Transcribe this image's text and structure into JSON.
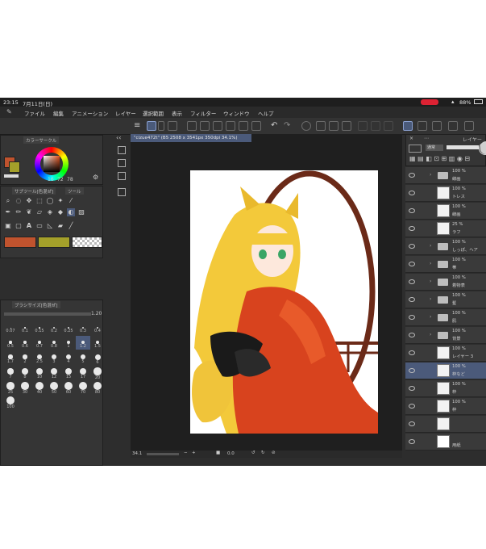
{
  "status": {
    "time": "23:15",
    "date": "7月11日(日)",
    "battery": "88%"
  },
  "menu": [
    "ファイル",
    "編集",
    "アニメーション",
    "レイヤー",
    "選択範囲",
    "表示",
    "フィルター",
    "ウィンドウ",
    "ヘルプ"
  ],
  "color_panel": {
    "tab_a": "カラーサークル",
    "h": "16",
    "s": "72",
    "v": "78"
  },
  "tool_panel": {
    "tab_a": "サブツール[色混ぜ]",
    "tab_b": "ツール"
  },
  "brush_panel": {
    "title": "ブラシサイズ[色混ぜ]",
    "scale": "1.20",
    "sizes": [
      "0.07",
      "0.1",
      "0.15",
      "0.2",
      "0.25",
      "0.3",
      "0.4",
      "0.5",
      "0.6",
      "0.7",
      "0.8",
      "1",
      "1.2",
      "1.5",
      "1.7",
      "2",
      "2.5",
      "3",
      "4",
      "5",
      "6",
      "7",
      "8",
      "10",
      "12",
      "15",
      "17",
      "20",
      "25",
      "30",
      "40",
      "50",
      "60",
      "70",
      "80",
      "100"
    ],
    "selected": "1.2"
  },
  "document": {
    "tab": "\"cizue472t\" (B5 2508 x 3541px 350dpi 34.1%)"
  },
  "canvas_footer": {
    "zoom": "34.1",
    "angle": "0.0"
  },
  "layer_panel": {
    "title": "レイヤー",
    "blend": "通常",
    "rows": [
      {
        "op": "100 %",
        "name": "線画",
        "type": "folder"
      },
      {
        "op": "100 %",
        "name": "トレス",
        "type": "layer"
      },
      {
        "op": "100 %",
        "name": "線画",
        "type": "layer"
      },
      {
        "op": "25 %",
        "name": "ラフ",
        "type": "layer"
      },
      {
        "op": "100 %",
        "name": "しっぽ、ヘア",
        "type": "folder"
      },
      {
        "op": "100 %",
        "name": "帯",
        "type": "folder"
      },
      {
        "op": "100 %",
        "name": "着物表",
        "type": "folder"
      },
      {
        "op": "100 %",
        "name": "髪",
        "type": "folder"
      },
      {
        "op": "100 %",
        "name": "肌",
        "type": "folder"
      },
      {
        "op": "100 %",
        "name": "背景",
        "type": "folder"
      },
      {
        "op": "100 %",
        "name": "レイヤー 3",
        "type": "layer"
      },
      {
        "op": "100 %",
        "name": "枠など",
        "type": "layer",
        "selected": true
      },
      {
        "op": "100 %",
        "name": "枠",
        "type": "layer"
      },
      {
        "op": "100 %",
        "name": "枠",
        "type": "layer"
      },
      {
        "op": "",
        "name": "",
        "type": "layer"
      },
      {
        "op": "",
        "name": "用紙",
        "type": "paper"
      }
    ]
  },
  "colors": {
    "main": "#c0532e",
    "sub": "#a4a02a",
    "accent": "#4a7bd0"
  }
}
